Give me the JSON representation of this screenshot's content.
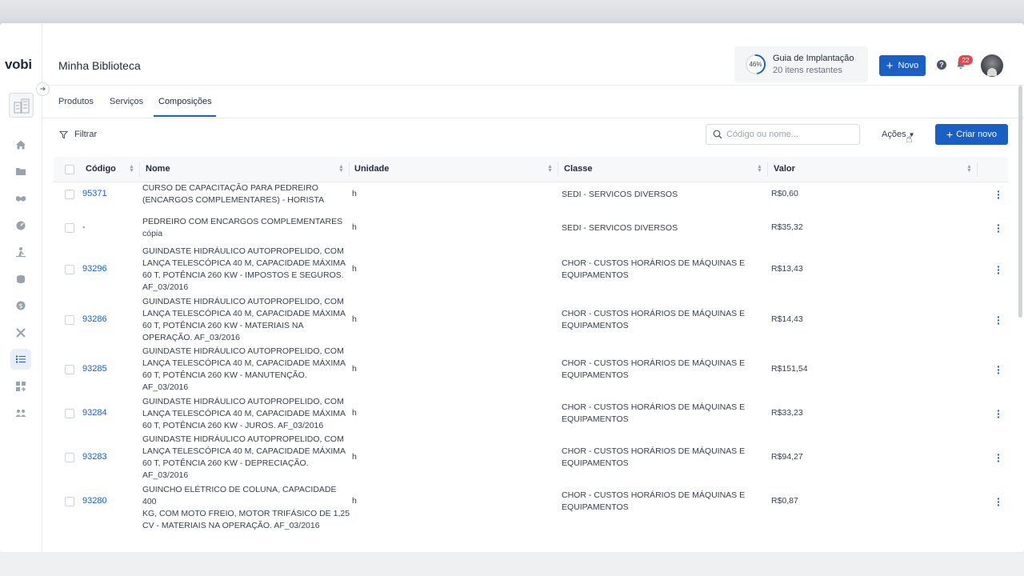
{
  "app": {
    "logo": "vobi",
    "page_title": "Minha Biblioteca"
  },
  "guide": {
    "percent": "46%",
    "title": "Guia de Implantação",
    "subtitle": "20 itens restantes",
    "progress": 0.46
  },
  "header": {
    "new_button": "Novo",
    "help": "?",
    "notifications_count": "22"
  },
  "tabs": [
    {
      "label": "Produtos",
      "active": false
    },
    {
      "label": "Serviços",
      "active": false
    },
    {
      "label": "Composições",
      "active": true
    }
  ],
  "toolbar": {
    "filter_label": "Filtrar",
    "search_placeholder": "Código ou nome...",
    "actions_label": "Ações",
    "create_button": "Criar novo"
  },
  "table": {
    "columns": [
      "Código",
      "Nome",
      "Unidade",
      "Classe",
      "Valor"
    ],
    "rows": [
      {
        "code": "95371",
        "name": [
          "CURSO DE CAPACITAÇÃO PARA PEDREIRO",
          "(ENCARGOS COMPLEMENTARES) - HORISTA"
        ],
        "unit": "h",
        "class": [
          "SEDI - SERVICOS DIVERSOS"
        ],
        "value": "R$0,60"
      },
      {
        "code": "-",
        "name": [
          "PEDREIRO COM ENCARGOS COMPLEMENTARES",
          "cópia"
        ],
        "unit": "h",
        "class": [
          "SEDI - SERVICOS DIVERSOS"
        ],
        "value": "R$35,32"
      },
      {
        "code": "93296",
        "name": [
          "GUINDASTE HIDRÁULICO AUTOPROPELIDO, COM",
          "LANÇA TELESCÓPICA 40 M, CAPACIDADE MÁXIMA",
          "60 T, POTÊNCIA 260 KW - IMPOSTOS E SEGUROS.",
          "AF_03/2016"
        ],
        "unit": "h",
        "class": [
          "CHOR - CUSTOS HORÁRIOS DE MÁQUINAS E",
          "EQUIPAMENTOS"
        ],
        "value": "R$13,43"
      },
      {
        "code": "93286",
        "name": [
          "GUINDASTE HIDRÁULICO AUTOPROPELIDO, COM",
          "LANÇA TELESCÓPICA 40 M, CAPACIDADE MÁXIMA",
          "60 T, POTÊNCIA 260 KW - MATERIAIS NA",
          "OPERAÇÃO. AF_03/2016"
        ],
        "unit": "h",
        "class": [
          "CHOR - CUSTOS HORÁRIOS DE MÁQUINAS E",
          "EQUIPAMENTOS"
        ],
        "value": "R$14,43"
      },
      {
        "code": "93285",
        "name": [
          "GUINDASTE HIDRÁULICO AUTOPROPELIDO, COM",
          "LANÇA TELESCÓPICA 40 M, CAPACIDADE MÁXIMA",
          "60 T, POTÊNCIA 260 KW - MANUTENÇÃO.",
          "AF_03/2016"
        ],
        "unit": "h",
        "class": [
          "CHOR - CUSTOS HORÁRIOS DE MÁQUINAS E",
          "EQUIPAMENTOS"
        ],
        "value": "R$151,54"
      },
      {
        "code": "93284",
        "name": [
          "GUINDASTE HIDRÁULICO AUTOPROPELIDO, COM",
          "LANÇA TELESCÓPICA 40 M, CAPACIDADE MÁXIMA",
          "60 T, POTÊNCIA 260 KW - JUROS. AF_03/2016"
        ],
        "unit": "h",
        "class": [
          "CHOR - CUSTOS HORÁRIOS DE MÁQUINAS E",
          "EQUIPAMENTOS"
        ],
        "value": "R$33,23"
      },
      {
        "code": "93283",
        "name": [
          "GUINDASTE HIDRÁULICO AUTOPROPELIDO, COM",
          "LANÇA TELESCÓPICA 40 M, CAPACIDADE MÁXIMA",
          "60 T, POTÊNCIA 260 KW - DEPRECIAÇÃO.",
          "AF_03/2016"
        ],
        "unit": "h",
        "class": [
          "CHOR - CUSTOS HORÁRIOS DE MÁQUINAS E",
          "EQUIPAMENTOS"
        ],
        "value": "R$94,27"
      },
      {
        "code": "93280",
        "name": [
          "GUINCHO ELÉTRICO DE COLUNA, CAPACIDADE 400",
          "KG, COM MOTO FREIO, MOTOR TRIFÁSICO DE 1,25",
          "CV - MATERIAIS NA OPERAÇÃO. AF_03/2016"
        ],
        "unit": "h",
        "class": [
          "CHOR - CUSTOS HORÁRIOS DE MÁQUINAS E",
          "EQUIPAMENTOS"
        ],
        "value": "R$0,87"
      }
    ]
  },
  "sidebar_icons": [
    "home-icon",
    "folder-icon",
    "handshake-icon",
    "gauge-icon",
    "worker-icon",
    "coins-icon",
    "dollar-icon",
    "tools-icon",
    "list-icon",
    "add-grid-icon",
    "team-icon"
  ],
  "colors": {
    "accent": "#1a5fc4",
    "badge": "#e5484d"
  }
}
